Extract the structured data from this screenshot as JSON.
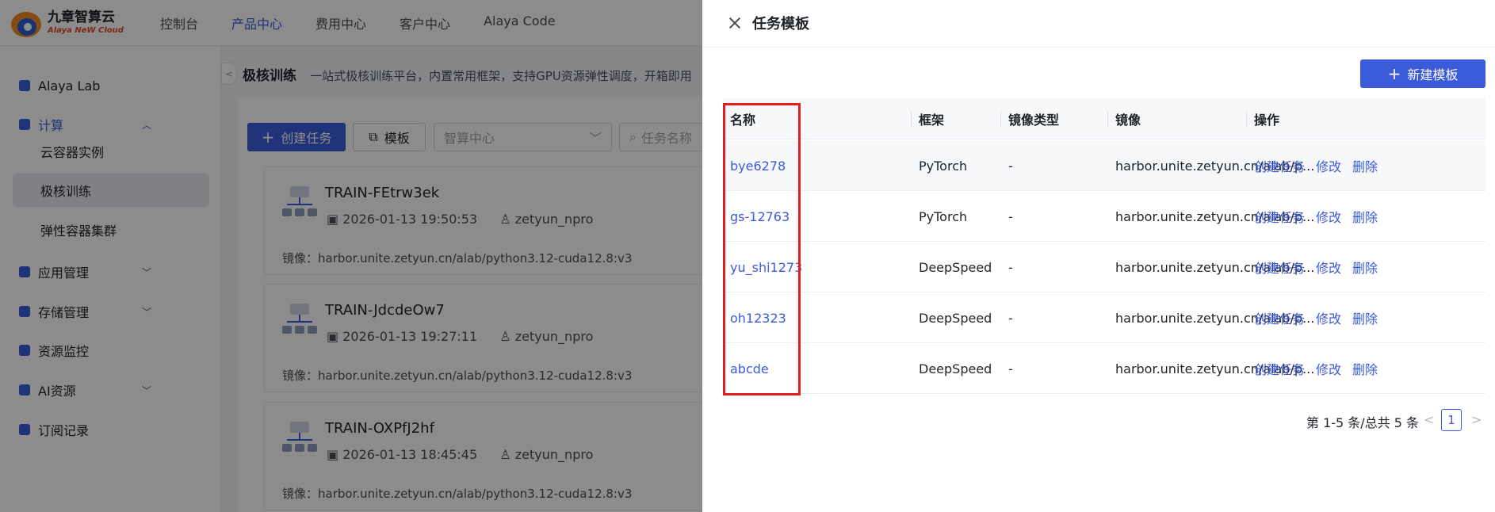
{
  "brand": {
    "title": "九章智算云",
    "subtitle": "Alaya NeW Cloud"
  },
  "topnav": [
    "控制台",
    "产品中心",
    "费用中心",
    "客户中心",
    "Alaya Code"
  ],
  "sidebar": {
    "items": [
      {
        "label": "Alaya Lab",
        "icon": "lab-icon"
      },
      {
        "label": "计算",
        "icon": "compute-icon"
      },
      {
        "label": "应用管理",
        "icon": "app-icon"
      },
      {
        "label": "存储管理",
        "icon": "storage-icon"
      },
      {
        "label": "资源监控",
        "icon": "monitor-icon"
      },
      {
        "label": "AI资源",
        "icon": "ai-icon"
      },
      {
        "label": "订阅记录",
        "icon": "subscription-icon"
      }
    ],
    "compute_children": [
      "云容器实例",
      "极核训练",
      "弹性容器集群"
    ]
  },
  "page": {
    "title": "极核训练",
    "description": "一站式极核训练平台，内置常用框架，支持GPU资源弹性调度，开箱即用"
  },
  "toolbar": {
    "create_task": "创建任务",
    "template": "模板",
    "compute_center_placeholder": "智算中心",
    "search_placeholder": "任务名称"
  },
  "tasks": [
    {
      "name": "TRAIN-FEtrw3ek",
      "time": "2026-01-13 19:50:53",
      "user": "zetyun_npro",
      "image_label": "镜像：",
      "image": "harbor.unite.zetyun.cn/alab/python3.12-cuda12.8:v3"
    },
    {
      "name": "TRAIN-JdcdeOw7",
      "time": "2026-01-13 19:27:11",
      "user": "zetyun_npro",
      "image_label": "镜像：",
      "image": "harbor.unite.zetyun.cn/alab/python3.12-cuda12.8:v3"
    },
    {
      "name": "TRAIN-OXPfJ2hf",
      "time": "2026-01-13 18:45:45",
      "user": "zetyun_npro",
      "image_label": "镜像：",
      "image": "harbor.unite.zetyun.cn/alab/python3.12-cuda12.8:v3"
    }
  ],
  "drawer": {
    "title": "任务模板",
    "new_button": "新建模板",
    "columns": [
      "名称",
      "框架",
      "镜像类型",
      "镜像",
      "操作"
    ],
    "rows": [
      {
        "name": "bye6278",
        "framework": "PyTorch",
        "image_type": "-",
        "image": "harbor.unite.zetyun.cn/alab/p..."
      },
      {
        "name": "gs-12763",
        "framework": "PyTorch",
        "image_type": "-",
        "image": "harbor.unite.zetyun.cn/alab/p..."
      },
      {
        "name": "yu_shi1273",
        "framework": "DeepSpeed",
        "image_type": "-",
        "image": "harbor.unite.zetyun.cn/alab/p..."
      },
      {
        "name": "oh12323",
        "framework": "DeepSpeed",
        "image_type": "-",
        "image": "harbor.unite.zetyun.cn/alab/p..."
      },
      {
        "name": "abcde",
        "framework": "DeepSpeed",
        "image_type": "-",
        "image": "harbor.unite.zetyun.cn/alab/p..."
      }
    ],
    "actions": [
      "创建任务",
      "修改",
      "删除"
    ],
    "pagination": {
      "summary": "第 1-5 条/总共 5 条",
      "current_page": "1"
    }
  },
  "colors": {
    "primary": "#3b5bdb",
    "highlight_box": "#e02020",
    "overlay": "rgba(0,0,0,0.45)"
  }
}
